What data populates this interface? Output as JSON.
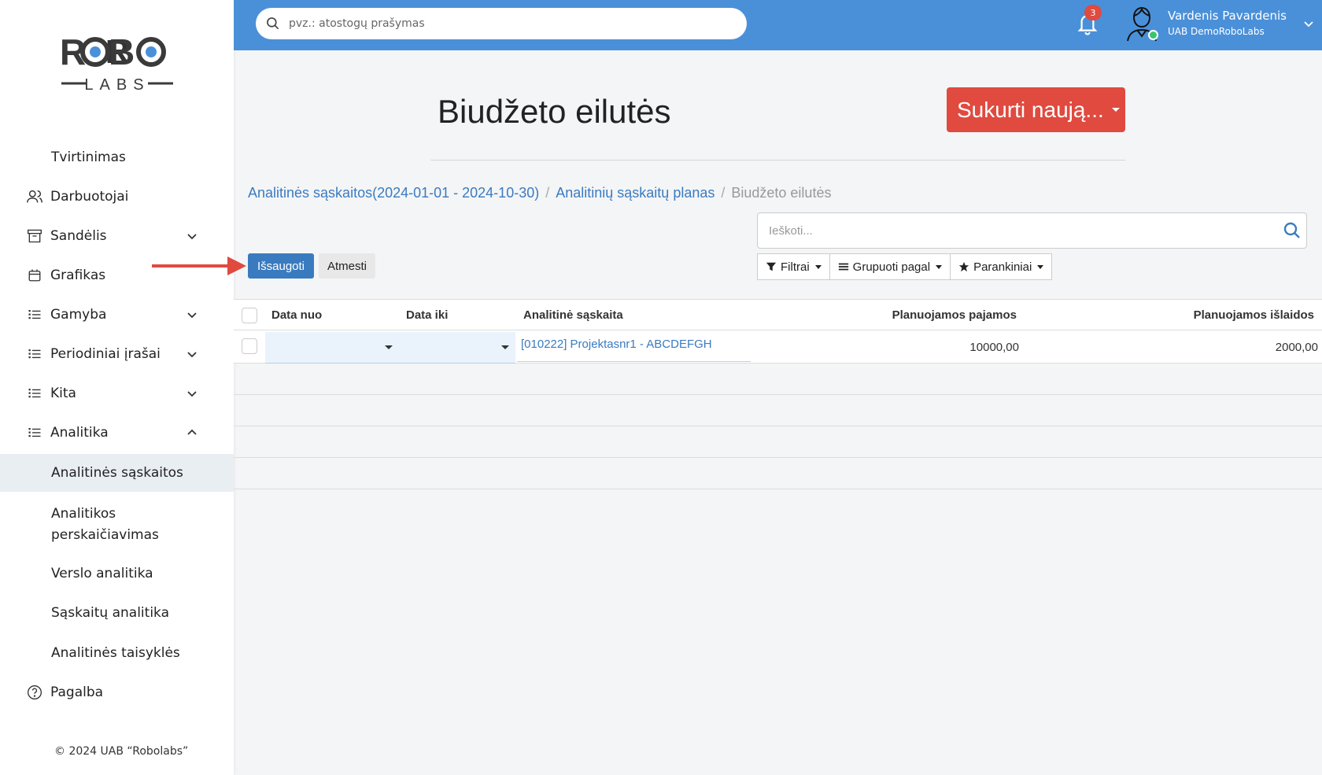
{
  "brand": {
    "logo_top": "ROBO",
    "logo_bottom": "LABS",
    "accent": "#4a90d9",
    "danger": "#e04a3f"
  },
  "sidebar": {
    "items": [
      {
        "label": "Tvirtinimas",
        "icon": "",
        "expandable": false
      },
      {
        "label": "Darbuotojai",
        "icon": "users-icon",
        "expandable": false
      },
      {
        "label": "Sandėlis",
        "icon": "archive-icon",
        "expandable": true
      },
      {
        "label": "Grafikas",
        "icon": "calendar-icon",
        "expandable": false
      },
      {
        "label": "Gamyba",
        "icon": "list-icon",
        "expandable": true
      },
      {
        "label": "Periodiniai įrašai",
        "icon": "list-icon",
        "expandable": true
      },
      {
        "label": "Kita",
        "icon": "list-icon",
        "expandable": true
      },
      {
        "label": "Analitika",
        "icon": "list-icon",
        "expandable": true,
        "expanded": true
      },
      {
        "label": "Analitinės sąskaitos",
        "sub": true,
        "active": true
      },
      {
        "label_line1": "Analitikos",
        "label_line2": "perskaičiavimas",
        "sub": true
      },
      {
        "label": "Verslo analitika",
        "sub": true
      },
      {
        "label": "Sąskaitų analitika",
        "sub": true
      },
      {
        "label": "Analitinės taisyklės",
        "sub": true
      },
      {
        "label": "Pagalba",
        "icon": "help-circle-icon"
      }
    ],
    "footer": "© 2024 UAB “Robolabs”"
  },
  "topbar": {
    "search_placeholder": "pvz.: atostogų prašymas",
    "notifications_count": "3",
    "user_name": "Vardenis Pavardenis",
    "company": "UAB DemoRoboLabs"
  },
  "page": {
    "title": "Biudžeto eilutės",
    "create_label": "Sukurti naują..."
  },
  "breadcrumb": {
    "items": [
      "Analitinės sąskaitos(2024-01-01 - 2024-10-30)",
      "Analitinių sąskaitų planas",
      "Biudžeto eilutės"
    ],
    "separator": "/"
  },
  "toolbar": {
    "save_label": "Išsaugoti",
    "discard_label": "Atmesti",
    "search_placeholder": "Ieškoti...",
    "filters_label": "Filtrai",
    "group_label": "Grupuoti pagal",
    "favorites_label": "Parankiniai"
  },
  "table": {
    "columns": [
      "Data nuo",
      "Data iki",
      "Analitinė sąskaita",
      "Planuojamos pajamos",
      "Planuojamos išlaidos"
    ],
    "rows": [
      {
        "date_from": "",
        "date_to": "",
        "account": "[010222] Projektasnr1 - ABCDEFGH",
        "income": "10000,00",
        "expense": "2000,00"
      }
    ]
  }
}
